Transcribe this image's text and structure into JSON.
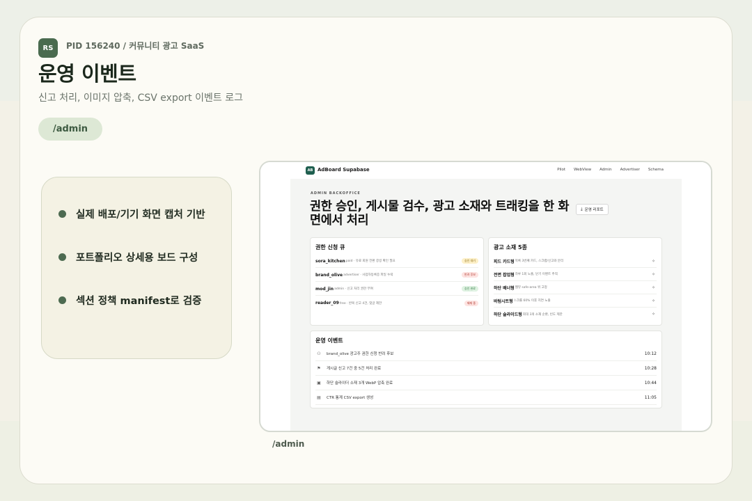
{
  "header": {
    "logo": "RS",
    "pid": "PID 156240 / 커뮤니티 광고 SaaS",
    "title": "운영 이벤트",
    "subtitle": "신고 처리, 이미지 압축, CSV export 이벤트 로그",
    "route": "/admin"
  },
  "features": [
    {
      "label": "실제 배포/기기 화면 캡처 기반"
    },
    {
      "label": "포트폴리오 상세용 보드 구성"
    },
    {
      "label": "섹션 정책 manifest로 검증"
    }
  ],
  "preview": {
    "caption": "/admin",
    "app": {
      "logo": "AB",
      "name": "AdBoard Supabase",
      "nav": [
        "Pilot",
        "WebView",
        "Admin",
        "Advertiser",
        "Schema"
      ],
      "eyebrow": "ADMIN BACKOFFICE",
      "hero": "권한 승인, 게시물 검수, 광고 소재와 트래킹을 한 화면에서 처리",
      "report_button": "운영 리포트",
      "queue": {
        "title": "권한 신청 큐",
        "rows": [
          {
            "name": "sora_kitchen",
            "meta": "paid · 유료 회원 전환 증빙 확인 필요",
            "badge": "승인 대기",
            "badge_bg": "#fdf0c8",
            "badge_fg": "#8a6a10"
          },
          {
            "name": "brand_olive",
            "meta": "advertiser · 사업자등록증 파일 누락",
            "badge": "반려 후보",
            "badge_bg": "#fde3e1",
            "badge_fg": "#b0362c"
          },
          {
            "name": "mod_jin",
            "meta": "admin · 신고 처리 권한 부여",
            "badge": "승인 완료",
            "badge_bg": "#dff2e2",
            "badge_fg": "#2e7a40"
          },
          {
            "name": "reader_09",
            "meta": "free · 반복 신고 4건, 댓글 제한",
            "badge": "제재 중",
            "badge_bg": "#fde3e1",
            "badge_fg": "#b0362c"
          }
        ]
      },
      "creatives": {
        "title": "광고 소재 5종",
        "rows": [
          {
            "name": "피드 카드형",
            "meta": "목록 3번째 카드, 스크랩/신고와 분리"
          },
          {
            "name": "전면 팝업형",
            "meta": "하루 1회 노출, 닫기 이벤트 추적"
          },
          {
            "name": "하단 배너형",
            "meta": "웹뷰 safe-area 위 고정"
          },
          {
            "name": "바텀시트형",
            "meta": "스크롤 60% 이후 지연 노출"
          },
          {
            "name": "하단 슬라이드형",
            "meta": "최대 3개 소재 순환, 빈도 제한"
          }
        ]
      },
      "events": {
        "title": "운영 이벤트",
        "rows": [
          {
            "icon": "users-icon",
            "glyph": "⚇",
            "text": "brand_olive 광고주 권한 신청 반려 후보",
            "time": "10:12"
          },
          {
            "icon": "flag-icon",
            "glyph": "⚑",
            "text": "게시글 신고 7건 중 5건 처리 완료",
            "time": "10:28"
          },
          {
            "icon": "image-icon",
            "glyph": "▣",
            "text": "하단 슬라이더 소재 3개 WebP 압축 완료",
            "time": "10:44"
          },
          {
            "icon": "file-icon",
            "glyph": "▤",
            "text": "CTR 통계 CSV export 생성",
            "time": "11:05"
          }
        ]
      }
    }
  },
  "colors": {
    "accent": "#4a6b4f",
    "pill_bg": "#dde8d5",
    "app_logo": "#1f5f4f"
  }
}
